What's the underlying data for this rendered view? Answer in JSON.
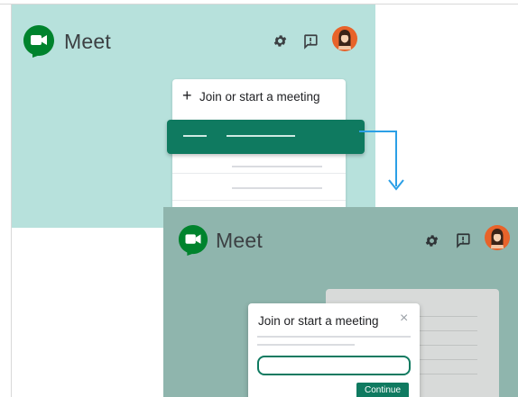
{
  "top": {
    "app_name": "Meet",
    "join_label": "Join or start a meeting",
    "plus_symbol": "+",
    "panel_color": "#b7e1dc"
  },
  "bottom": {
    "app_name": "Meet",
    "dialog_title": "Join or start a meeting",
    "close_symbol": "×",
    "continue_label": "Continue",
    "panel_color": "#8fb5ad"
  },
  "icons": {
    "logo": "google-meet-logo-icon",
    "settings": "gear-icon",
    "feedback": "feedback-icon",
    "avatar": "user-avatar"
  },
  "colors": {
    "accent": "#0f7a60",
    "arrow": "#2b9fe6",
    "logo_green": "#00832d"
  }
}
